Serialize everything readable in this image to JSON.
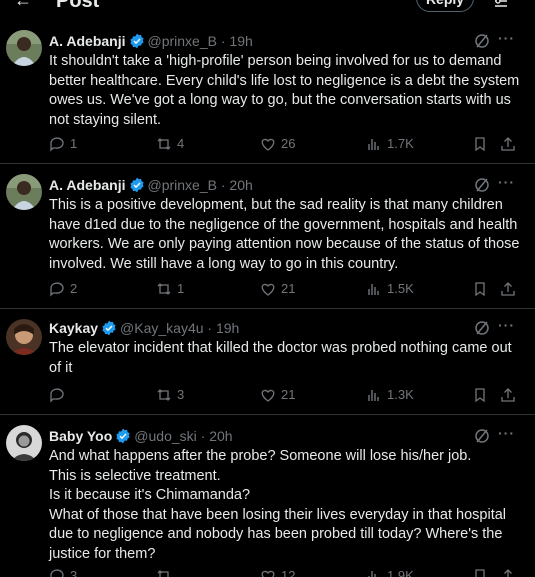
{
  "header": {
    "title": "Post",
    "reply_label": "Reply"
  },
  "tweets": [
    {
      "name": "A. Adebanji",
      "handle": "@prinxe_B",
      "time": "19h",
      "text": "It shouldn't take a 'high-profile' person being involved for us to demand better healthcare. Every child's life lost to negligence is a debt the system owes us. We've got a long way to go, but the conversation starts with us not staying silent.",
      "replies": "1",
      "reposts": "4",
      "likes": "26",
      "views": "1.7K"
    },
    {
      "name": "A. Adebanji",
      "handle": "@prinxe_B",
      "time": "20h",
      "text": "This is a positive development, but the sad reality is that many children have d1ed due to the negligence of the government, hospitals and health workers. We are only paying attention now because of the status of those involved. We still have a long way to go in this country.",
      "replies": "2",
      "reposts": "1",
      "likes": "21",
      "views": "1.5K"
    },
    {
      "name": "Kaykay",
      "handle": "@Kay_kay4u",
      "time": "19h",
      "text": "The elevator incident that killed the doctor was probed nothing came out of it",
      "replies": "",
      "reposts": "3",
      "likes": "21",
      "views": "1.3K"
    },
    {
      "name": "Baby Yoo",
      "handle": "@udo_ski",
      "time": "20h",
      "text": "And what happens after the probe? Someone will lose his/her job.\nThis is selective treatment.\nIs it because it's Chimamanda?\nWhat of those that have been losing their lives everyday in that hospital due to negligence and nobody has been probed till today? Where's the justice for them?",
      "replies": "3",
      "reposts": "",
      "likes": "12",
      "views": "1.9K"
    }
  ],
  "colors": {
    "background": "#000000",
    "text": "#e7e9ea",
    "muted": "#71767b",
    "verified": "#1d9bf0",
    "divider": "#2f3336"
  }
}
